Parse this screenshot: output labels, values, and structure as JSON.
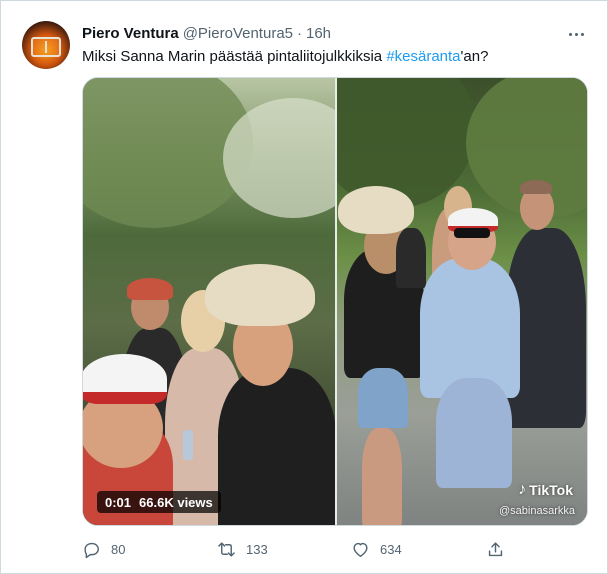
{
  "tweet": {
    "display_name": "Piero Ventura",
    "handle": "@PieroVentura5",
    "separator": "·",
    "time": "16h",
    "text_before": "Miksi Sanna Marin päästää pintaliitojulkkiksia ",
    "hashtag": "#kesäranta",
    "text_after": "'an?"
  },
  "media": {
    "duration": "0:01",
    "views": "66.6K views",
    "watermark": "TikTok",
    "watermark_handle": "@sabinasarkka"
  },
  "actions": {
    "replies": "80",
    "retweets": "133",
    "likes": "634"
  },
  "icons": [
    "more-icon",
    "reply-icon",
    "retweet-icon",
    "like-icon",
    "share-icon",
    "tiktok-icon"
  ],
  "colors": {
    "link": "#1d9bf0",
    "secondary_text": "#536471",
    "text": "#0f1419",
    "border": "#cfd9de"
  }
}
